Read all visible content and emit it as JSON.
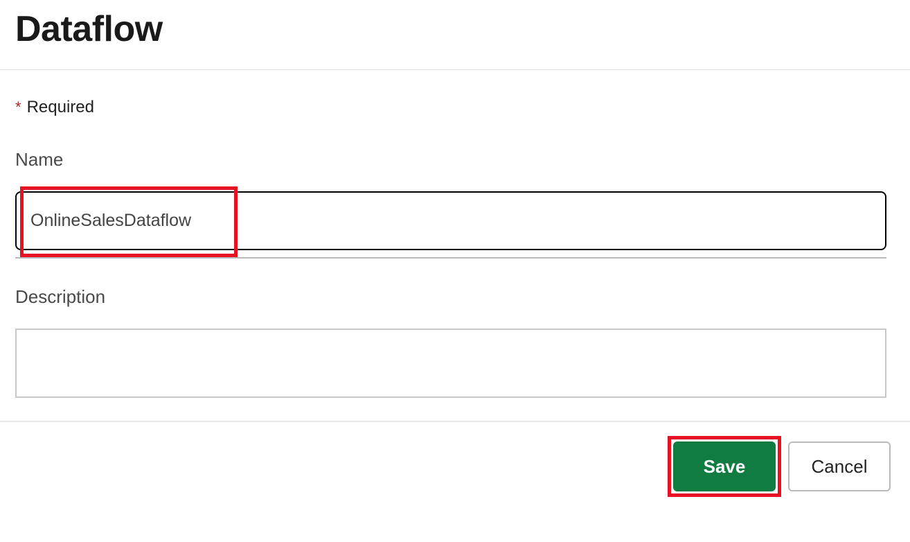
{
  "page": {
    "title": "Dataflow"
  },
  "required": {
    "asterisk": "*",
    "label": "Required"
  },
  "fields": {
    "name": {
      "label": "Name",
      "value": "OnlineSalesDataflow"
    },
    "description": {
      "label": "Description",
      "value": ""
    }
  },
  "buttons": {
    "save": "Save",
    "cancel": "Cancel"
  },
  "colors": {
    "primary": "#107c41",
    "highlight": "#e81123"
  }
}
